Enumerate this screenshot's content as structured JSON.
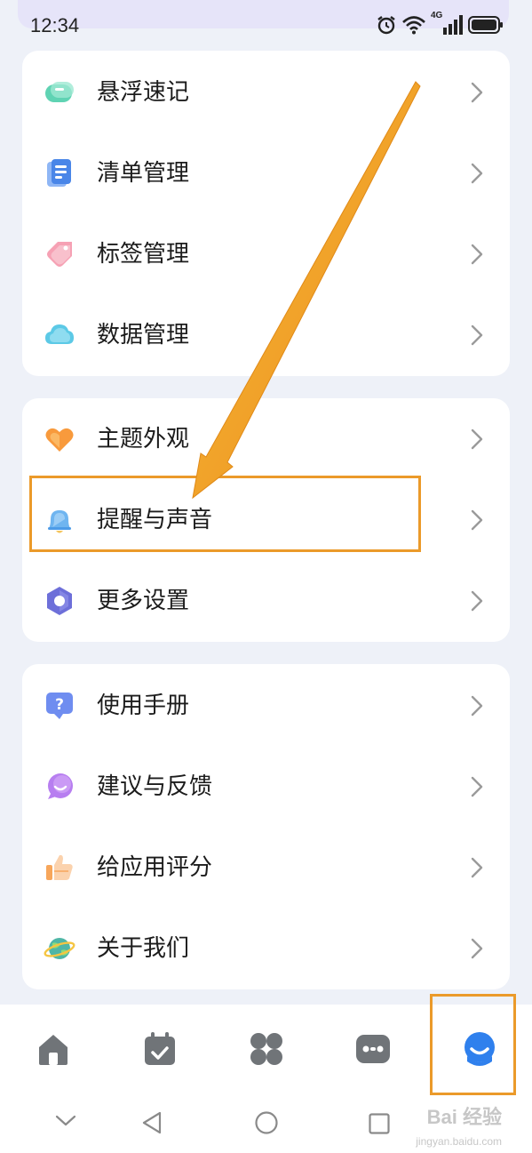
{
  "status_bar": {
    "time": "12:34",
    "network": "4G"
  },
  "groups": [
    {
      "items": [
        {
          "label": "悬浮速记",
          "icon": "floating-note-icon"
        },
        {
          "label": "清单管理",
          "icon": "list-manage-icon"
        },
        {
          "label": "标签管理",
          "icon": "tag-icon"
        },
        {
          "label": "数据管理",
          "icon": "cloud-data-icon"
        }
      ]
    },
    {
      "items": [
        {
          "label": "主题外观",
          "icon": "heart-theme-icon"
        },
        {
          "label": "提醒与声音",
          "icon": "bell-icon"
        },
        {
          "label": "更多设置",
          "icon": "hexagon-settings-icon"
        }
      ]
    },
    {
      "items": [
        {
          "label": "使用手册",
          "icon": "help-manual-icon"
        },
        {
          "label": "建议与反馈",
          "icon": "feedback-chat-icon"
        },
        {
          "label": "给应用评分",
          "icon": "thumbs-up-icon"
        },
        {
          "label": "关于我们",
          "icon": "planet-icon"
        }
      ]
    }
  ],
  "tab_bar": [
    {
      "icon": "home-icon",
      "active": false
    },
    {
      "icon": "calendar-icon",
      "active": false
    },
    {
      "icon": "grid-apps-icon",
      "active": false
    },
    {
      "icon": "robot-icon",
      "active": false
    },
    {
      "icon": "profile-icon",
      "active": true
    }
  ],
  "system_nav": [
    "back-chevron-icon",
    "back-triangle-icon",
    "home-circle-icon",
    "recents-square-icon"
  ],
  "watermark": {
    "text": "Bai 经验",
    "sub": "jingyan.baidu.com"
  },
  "colors": {
    "highlight": "#eb9a2a",
    "arrow": "#f0a323",
    "active_tab": "#2f80ed"
  }
}
